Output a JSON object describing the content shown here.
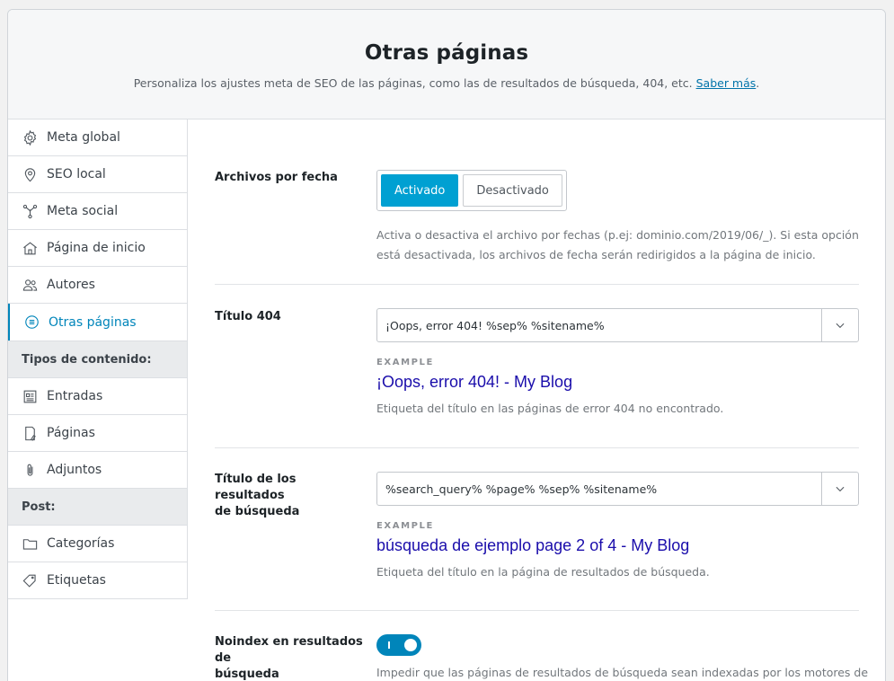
{
  "header": {
    "title": "Otras páginas",
    "description": "Personaliza los ajustes meta de SEO de las páginas, como las de resultados de búsqueda, 404, etc.",
    "link_text": "Saber más",
    "period": "."
  },
  "sidebar": {
    "items": [
      {
        "label": "Meta global",
        "icon": "gear-icon"
      },
      {
        "label": "SEO local",
        "icon": "location-pin-icon"
      },
      {
        "label": "Meta social",
        "icon": "share-nodes-icon"
      },
      {
        "label": "Página de inicio",
        "icon": "home-icon"
      },
      {
        "label": "Autores",
        "icon": "users-icon"
      },
      {
        "label": "Otras páginas",
        "icon": "list-circle-icon",
        "active": true
      }
    ],
    "group_content": "Tipos de contenido:",
    "content_items": [
      {
        "label": "Entradas",
        "icon": "posts-icon"
      },
      {
        "label": "Páginas",
        "icon": "pages-icon"
      },
      {
        "label": "Adjuntos",
        "icon": "paperclip-icon"
      }
    ],
    "group_post": "Post:",
    "post_items": [
      {
        "label": "Categorías",
        "icon": "folder-icon"
      },
      {
        "label": "Etiquetas",
        "icon": "tag-icon"
      }
    ]
  },
  "settings": {
    "date_archives": {
      "label": "Archivos por fecha",
      "on_label": "Activado",
      "off_label": "Desactivado",
      "selected": "Activado",
      "help_line1": "Activa o desactiva el archivo por fechas (p.ej: dominio.com/2019/06/_). Si esta opción",
      "help_line2": "está desactivada, los archivos de fecha serán redirigidos a la página de inicio."
    },
    "title_404": {
      "label": "Título 404",
      "value": "¡Oops, error 404! %sep% %sitename%",
      "example_label": "EXAMPLE",
      "example_value": "¡Oops, error 404! - My Blog",
      "help": "Etiqueta del título en las páginas de error 404 no encontrado."
    },
    "search_title": {
      "label_line1": "Título de los resultados",
      "label_line2": "de búsqueda",
      "value": "%search_query% %page% %sep% %sitename%",
      "example_label": "EXAMPLE",
      "example_value": "búsqueda de ejemplo page 2 of 4 - My Blog",
      "help": "Etiqueta del título en la página de resultados de búsqueda."
    },
    "noindex_search": {
      "label_line1": "Noindex en resultados de",
      "label_line2": "búsqueda",
      "enabled": true,
      "help": "Impedir que las páginas de resultados de búsqueda sean indexadas por los motores de"
    }
  },
  "colors": {
    "accent": "#0085ba",
    "button_active": "#00a0d2",
    "example_link": "#1a0dab"
  }
}
